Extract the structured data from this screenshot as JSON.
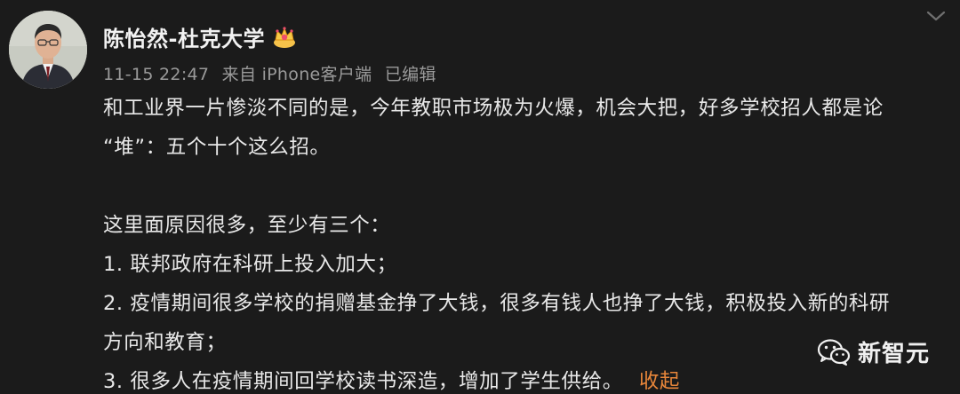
{
  "post": {
    "author": "陈怡然-杜克大学",
    "timestamp": "11-15 22:47",
    "source": "来自 iPhone客户端",
    "edited": "已编辑",
    "paragraph1_line1": "和工业界一片惨淡不同的是，今年教职市场极为火爆，机会大把，好多学校招人都是论",
    "paragraph1_line2": "“堆”：五个十个这么招。",
    "paragraph2_intro": "这里面原因很多，至少有三个：",
    "item1": "1. 联邦政府在科研上投入加大；",
    "item2_line1": "2. 疫情期间很多学校的捐赠基金挣了大钱，很多有钱人也挣了大钱，积极投入新的科研",
    "item2_line2": "方向和教育；",
    "item3": "3. 很多人在疫情期间回学校读书深造，增加了学生供给。",
    "collapse_label": "收起"
  },
  "watermark": {
    "text": "新智元"
  },
  "icons": {
    "avatar": "avatar-photo",
    "badge": "vip-crown-badge-icon",
    "chevron": "chevron-down-icon",
    "wechat": "wechat-icon"
  },
  "colors": {
    "background": "#1b1b1b",
    "text": "#e8e8e8",
    "meta": "#9a9a9a",
    "link": "#e8863a"
  }
}
